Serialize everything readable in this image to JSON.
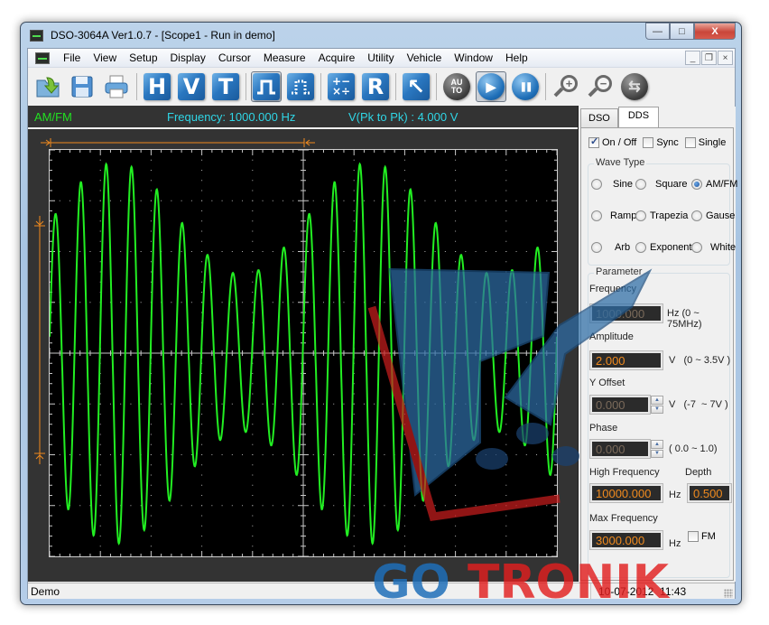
{
  "window": {
    "title": "DSO-3064A Ver1.0.7 - [Scope1 - Run in demo]",
    "controls": {
      "minimize": "—",
      "maximize": "□",
      "close": "X"
    }
  },
  "menubar": {
    "items": [
      "File",
      "View",
      "Setup",
      "Display",
      "Cursor",
      "Measure",
      "Acquire",
      "Utility",
      "Vehicle",
      "Window",
      "Help"
    ],
    "mdi_controls": {
      "minimize": "_",
      "restore": "❐",
      "close": "×"
    }
  },
  "toolbar": {
    "buttons": [
      {
        "name": "open-icon",
        "label": ""
      },
      {
        "name": "save-icon",
        "label": ""
      },
      {
        "name": "print-icon",
        "label": ""
      },
      {
        "name": "horizontal-icon",
        "label": "H"
      },
      {
        "name": "vertical-icon",
        "label": "V"
      },
      {
        "name": "trigger-icon",
        "label": "T"
      },
      {
        "name": "single-pulse-icon",
        "label": "⎍",
        "active": true
      },
      {
        "name": "dotted-pulse-icon",
        "label": "∷"
      },
      {
        "name": "math-icon",
        "label": "±×"
      },
      {
        "name": "ref-icon",
        "label": "R"
      },
      {
        "name": "cursor-select-icon",
        "label": "↖"
      },
      {
        "name": "auto-icon",
        "label": "AU TO"
      },
      {
        "name": "run-icon",
        "label": "▶",
        "active": true
      },
      {
        "name": "pause-icon",
        "label": "❚❚"
      },
      {
        "name": "zoom-in-icon",
        "label": "+"
      },
      {
        "name": "zoom-out-icon",
        "label": "−"
      },
      {
        "name": "swap-icon",
        "label": "⇆"
      }
    ]
  },
  "scope": {
    "mode": "AM/FM",
    "frequency_text": "Frequency: 1000.000 Hz",
    "vpp_text": "V(Pk to Pk) : 4.000 V",
    "trace_color": "#22ee22",
    "marker_color": "#f08a1e",
    "waveform": {
      "carrier_cycles_visible": 20,
      "amplitude_divs_min": 1.55,
      "amplitude_divs_max": 3.75,
      "envelope_period_cycles": 10
    }
  },
  "side_panel": {
    "tabs": [
      {
        "label": "DSO",
        "active": false
      },
      {
        "label": "DDS",
        "active": true
      }
    ],
    "checkboxes": [
      {
        "label": "On / Off",
        "checked": true
      },
      {
        "label": "Sync",
        "checked": false
      },
      {
        "label": "Single",
        "checked": false
      }
    ],
    "wave_type": {
      "title": "Wave Type",
      "options": [
        {
          "label": "Sine",
          "selected": false
        },
        {
          "label": "Square",
          "selected": false
        },
        {
          "label": "AM/FM",
          "selected": true
        },
        {
          "label": "Ramp",
          "selected": false
        },
        {
          "label": "Trapezia",
          "selected": false
        },
        {
          "label": "Gause",
          "selected": false
        },
        {
          "label": "Arb",
          "selected": false
        },
        {
          "label": "Exponent",
          "selected": false
        },
        {
          "label": "White",
          "selected": false
        }
      ]
    },
    "parameter": {
      "title": "Parameter",
      "frequency": {
        "label": "Frequency",
        "value": "1000.000",
        "unit": "Hz (0 ~ 75MHz)"
      },
      "amplitude": {
        "label": "Amplitude",
        "value": "2.000",
        "unit": "V   (0 ~ 3.5V )"
      },
      "y_offset": {
        "label": "Y Offset",
        "value": "0.000",
        "unit": "V   (-7  ~ 7V )"
      },
      "phase": {
        "label": "Phase",
        "value": "0.000",
        "unit": "( 0.0 ~ 1.0)"
      },
      "high_frequency": {
        "label": "High Frequency",
        "value": "10000.000",
        "unit": "Hz"
      },
      "depth": {
        "label": "Depth",
        "value": "0.500"
      },
      "max_frequency": {
        "label": "Max Frequency",
        "value": "3000.000",
        "unit": "Hz"
      },
      "fm": {
        "label": "FM",
        "checked": false
      }
    }
  },
  "statusbar": {
    "left": "Demo",
    "right": "10-07-2012  11:43"
  },
  "watermark": {
    "text_blue": "GO",
    "text_red": "TRONIK"
  }
}
